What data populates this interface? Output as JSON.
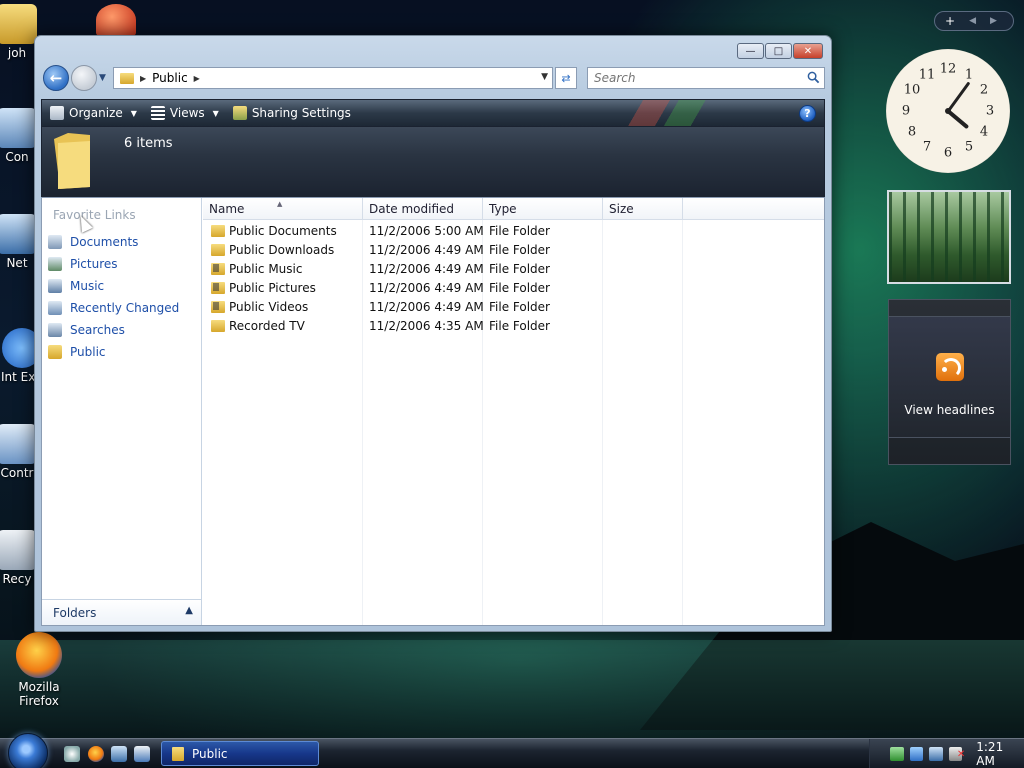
{
  "desktop": {
    "icons": [
      {
        "label": "joh"
      },
      {
        "label": "Con"
      },
      {
        "label": "Net"
      },
      {
        "label": "Int Exp"
      },
      {
        "label": "Contr"
      },
      {
        "label": "Recy"
      },
      {
        "label": "Mozilla Firefox"
      }
    ]
  },
  "window": {
    "address_segment": "Public",
    "search_placeholder": "Search",
    "toolbar": {
      "organize": "Organize",
      "views": "Views",
      "sharing": "Sharing Settings",
      "help": "?"
    },
    "items_count": "6 items",
    "nav": {
      "heading": "Favorite Links",
      "items": [
        {
          "label": "Documents"
        },
        {
          "label": "Pictures"
        },
        {
          "label": "Music"
        },
        {
          "label": "Recently Changed"
        },
        {
          "label": "Searches"
        },
        {
          "label": "Public"
        }
      ],
      "folders_label": "Folders"
    },
    "columns": [
      "Name",
      "Date modified",
      "Type",
      "Size"
    ],
    "files": [
      {
        "name": "Public Documents",
        "date": "11/2/2006 5:00 AM",
        "type": "File Folder",
        "size": ""
      },
      {
        "name": "Public Downloads",
        "date": "11/2/2006 4:49 AM",
        "type": "File Folder",
        "size": ""
      },
      {
        "name": "Public Music",
        "date": "11/2/2006 4:49 AM",
        "type": "File Folder",
        "size": ""
      },
      {
        "name": "Public Pictures",
        "date": "11/2/2006 4:49 AM",
        "type": "File Folder",
        "size": ""
      },
      {
        "name": "Public Videos",
        "date": "11/2/2006 4:49 AM",
        "type": "File Folder",
        "size": ""
      },
      {
        "name": "Recorded TV",
        "date": "11/2/2006 4:35 AM",
        "type": "File Folder",
        "size": ""
      }
    ]
  },
  "sidebar": {
    "add_button": "+",
    "clock_numbers": [
      "12",
      "1",
      "2",
      "3",
      "4",
      "5",
      "6",
      "7",
      "8",
      "9",
      "10",
      "11"
    ],
    "feed_label": "View headlines"
  },
  "taskbar": {
    "task_label": "Public",
    "time": "1:21 AM"
  },
  "colors": {
    "link_blue": "#1e4fa8",
    "toolbar_dark": "#2c3948",
    "folder_yellow": "#d6a72c"
  }
}
